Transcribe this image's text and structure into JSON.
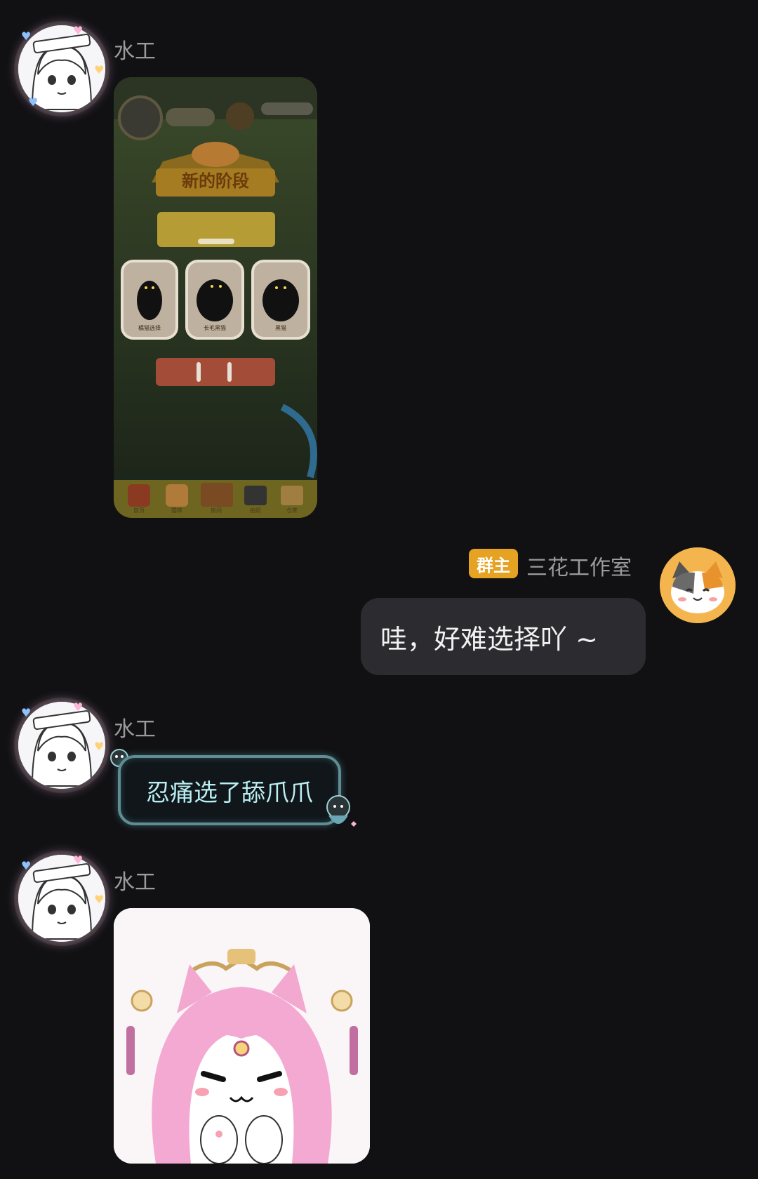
{
  "messages": [
    {
      "sender": "水工",
      "type": "image",
      "image_content": {
        "banner": "新的阶段",
        "cat_labels": [
          "橘猫选择",
          "长毛黑猫",
          "黑猫"
        ],
        "nav_labels": [
          "首页",
          "猫咪",
          "房间",
          "拍照",
          "仓库"
        ]
      }
    },
    {
      "sender": "三花工作室",
      "role_badge": "群主",
      "type": "text",
      "text": "哇，好难选择吖 ~"
    },
    {
      "sender": "水工",
      "type": "text",
      "text": "忍痛选了舔爪爪"
    },
    {
      "sender": "水工",
      "type": "sticker"
    }
  ],
  "colors": {
    "background": "#111114",
    "bubble_right": "#2b2b30",
    "badge": "#e6a323",
    "cyan_text": "#b9eef2",
    "name_text": "#9a9a9f"
  }
}
